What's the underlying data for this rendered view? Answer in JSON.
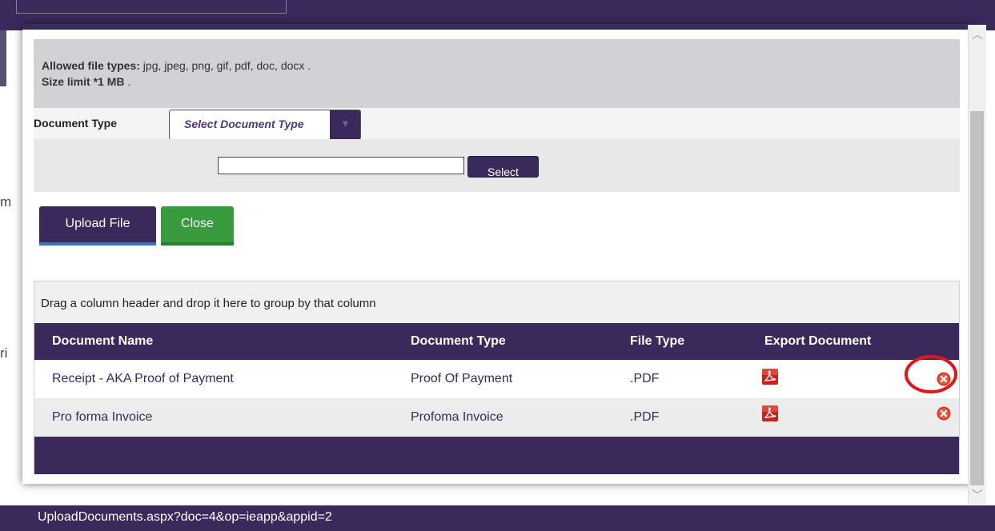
{
  "background": {
    "side_letters": [
      "m",
      "ri"
    ]
  },
  "info": {
    "allowed_label": "Allowed file types:",
    "allowed_types": " jpg, jpeg, png, gif, pdf, doc, docx .",
    "size_label": "Size limit *1 MB",
    "size_suffix": " ."
  },
  "document_type": {
    "label": "Document Type",
    "selected": "Select Document Type"
  },
  "file": {
    "value": "",
    "select_label": "Select"
  },
  "actions": {
    "upload_label": "Upload File",
    "close_label": "Close"
  },
  "grid": {
    "group_hint": "Drag a column header and drop it here to group by that column",
    "columns": [
      "Document Name",
      "Document Type",
      "File Type",
      "Export Document"
    ],
    "rows": [
      {
        "name": "Receipt - AKA Proof of Payment",
        "type": "Proof Of Payment",
        "file_type": ".PDF"
      },
      {
        "name": "Pro forma Invoice",
        "type": "Profoma Invoice",
        "file_type": ".PDF"
      }
    ]
  },
  "status_bar": {
    "url": "UploadDocuments.aspx?doc=4&op=ieapp&appid=2"
  },
  "colors": {
    "brand": "#3a2a5c",
    "close_green": "#3a9a3e",
    "delete_red": "#d9381e",
    "highlight_red": "#e4141b"
  },
  "icons": [
    "pdf-icon",
    "delete-icon",
    "chevron-down-icon",
    "chevron-up-icon"
  ]
}
